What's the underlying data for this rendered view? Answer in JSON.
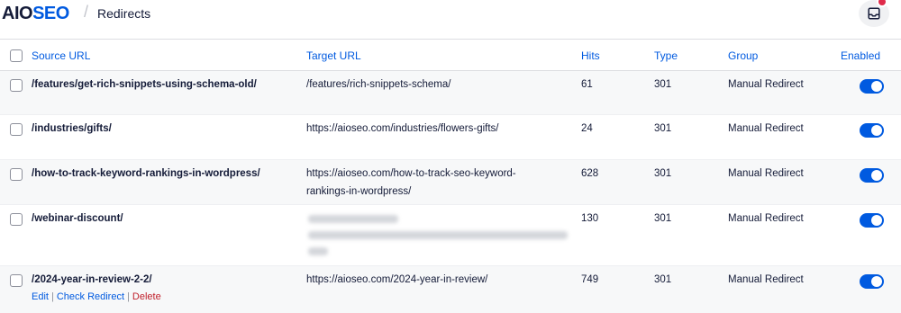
{
  "header": {
    "logo_aio": "AIO",
    "logo_seo": "SE",
    "logo_o": "O",
    "separator": "/",
    "breadcrumb": "Redirects"
  },
  "table": {
    "columns": {
      "source": "Source URL",
      "target": "Target URL",
      "hits": "Hits",
      "type": "Type",
      "group": "Group",
      "enabled": "Enabled"
    },
    "rows": [
      {
        "source": "/features/get-rich-snippets-using-schema-old/",
        "target": "/features/rich-snippets-schema/",
        "target_line2": "",
        "hits": "61",
        "type": "301",
        "group": "Manual Redirect",
        "enabled": true
      },
      {
        "source": "/industries/gifts/",
        "target": "https://aioseo.com/industries/flowers-gifts/",
        "target_line2": "",
        "hits": "24",
        "type": "301",
        "group": "Manual Redirect",
        "enabled": true
      },
      {
        "source": "/how-to-track-keyword-rankings-in-wordpress/",
        "target": "https://aioseo.com/how-to-track-seo-keyword-",
        "target_line2": "rankings-in-wordpress/",
        "hits": "628",
        "type": "301",
        "group": "Manual Redirect",
        "enabled": true
      },
      {
        "source": "/webinar-discount/",
        "target": "",
        "target_line2": "",
        "target_blurred": true,
        "hits": "130",
        "type": "301",
        "group": "Manual Redirect",
        "enabled": true
      },
      {
        "source": "/2024-year-in-review-2-2/",
        "target": "https://aioseo.com/2024-year-in-review/",
        "target_line2": "",
        "hits": "749",
        "type": "301",
        "group": "Manual Redirect",
        "enabled": true,
        "actions": {
          "edit": "Edit",
          "check": "Check Redirect",
          "delete": "Delete",
          "pipe": "|"
        }
      }
    ]
  },
  "colors": {
    "accent": "#005ae0",
    "danger": "#c0202b",
    "notification": "#df2a4a"
  }
}
